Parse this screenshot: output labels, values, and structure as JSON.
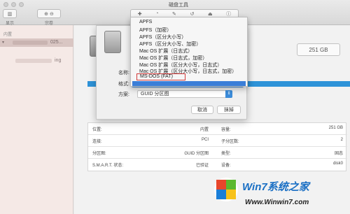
{
  "window": {
    "title": "磁盘工具"
  },
  "toolbar": {
    "display_label": "显示",
    "volume_label": "宗卷"
  },
  "sidebar": {
    "section_header": "内置",
    "disk_item": {
      "label": "025..."
    },
    "volume_item": {
      "label": "ing"
    }
  },
  "main": {
    "capacity_badge": "251 GB",
    "info_rows": [
      {
        "l1": "位置:",
        "v1": "内置",
        "l2": "容量:",
        "v2": "251 GB"
      },
      {
        "l1": "连接:",
        "v1": "PCI",
        "l2": "子分区数:",
        "v2": "2"
      },
      {
        "l1": "分区图:",
        "v1": "GUID 分区图",
        "l2": "类型:",
        "v2": "固态"
      },
      {
        "l1": "S.M.A.R.T. 状态:",
        "v1": "已验证",
        "l2": "设备:",
        "v2": "disk0"
      }
    ]
  },
  "erase_sheet": {
    "name_label": "名称:",
    "format_label": "格式:",
    "scheme_label": "方案:",
    "scheme_value": "GUID 分区图",
    "cancel_label": "取消",
    "erase_label": "抹掉"
  },
  "format_menu": {
    "items": [
      "APFS",
      "APFS（加密）",
      "APFS（区分大小写）",
      "APFS（区分大小写、加密）",
      "Mac OS 扩展（日志式）",
      "Mac OS 扩展（日志式，加密）",
      "Mac OS 扩展（区分大小写，日志式）",
      "Mac OS 扩展（区分大小写，日志式，加密）"
    ],
    "highlighted": "MS-DOS (FAT)"
  },
  "watermark": {
    "brand": "Win7系统之家",
    "url": "Www.Winwin7.com"
  },
  "colors": {
    "accent": "#3b8bd9",
    "highlight_box": "#d23a3a"
  }
}
